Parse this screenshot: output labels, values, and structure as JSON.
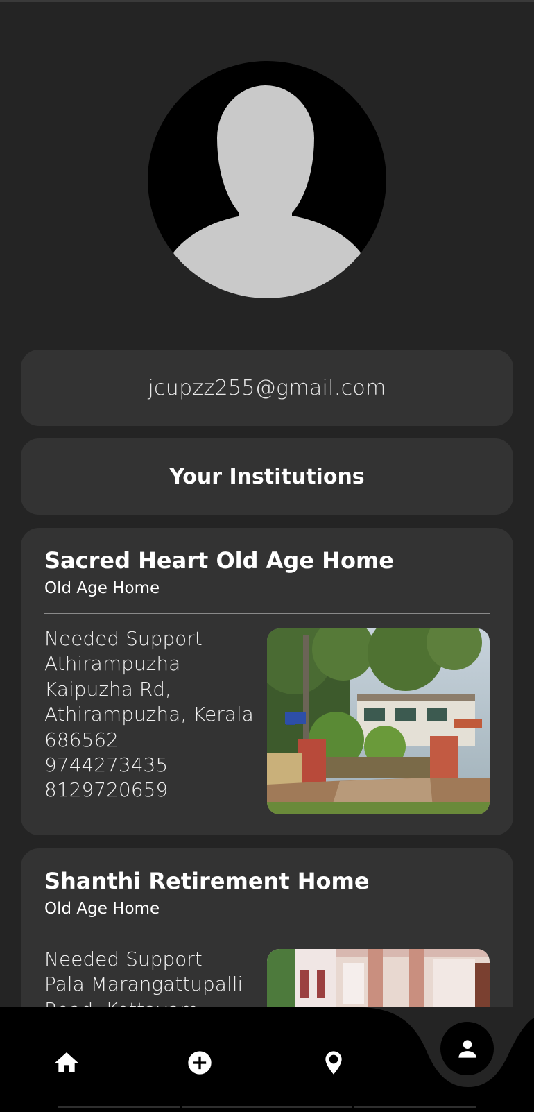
{
  "profile": {
    "email": "jcupzz255@gmail.com"
  },
  "section": {
    "title": "Your Institutions"
  },
  "institutions": [
    {
      "name": "Sacred Heart Old Age Home",
      "type": "Old Age Home",
      "details": [
        "Needed Support",
        "Athirampuzha",
        "Kaipuzha Rd,",
        "Athirampuzha, Kerala",
        "686562",
        "9744273435",
        "8129720659"
      ]
    },
    {
      "name": "Shanthi Retirement Home",
      "type": "Old Age Home",
      "details": [
        "Needed Support",
        "Pala Marangattupalli",
        "Road, Kottayam"
      ]
    }
  ],
  "nav": {
    "items": [
      "home-icon",
      "add-circle-icon",
      "location-pin-icon",
      "person-icon"
    ],
    "active": "person-icon"
  },
  "colors": {
    "background": "#242424",
    "panel": "#333333",
    "navbar": "#000000"
  }
}
